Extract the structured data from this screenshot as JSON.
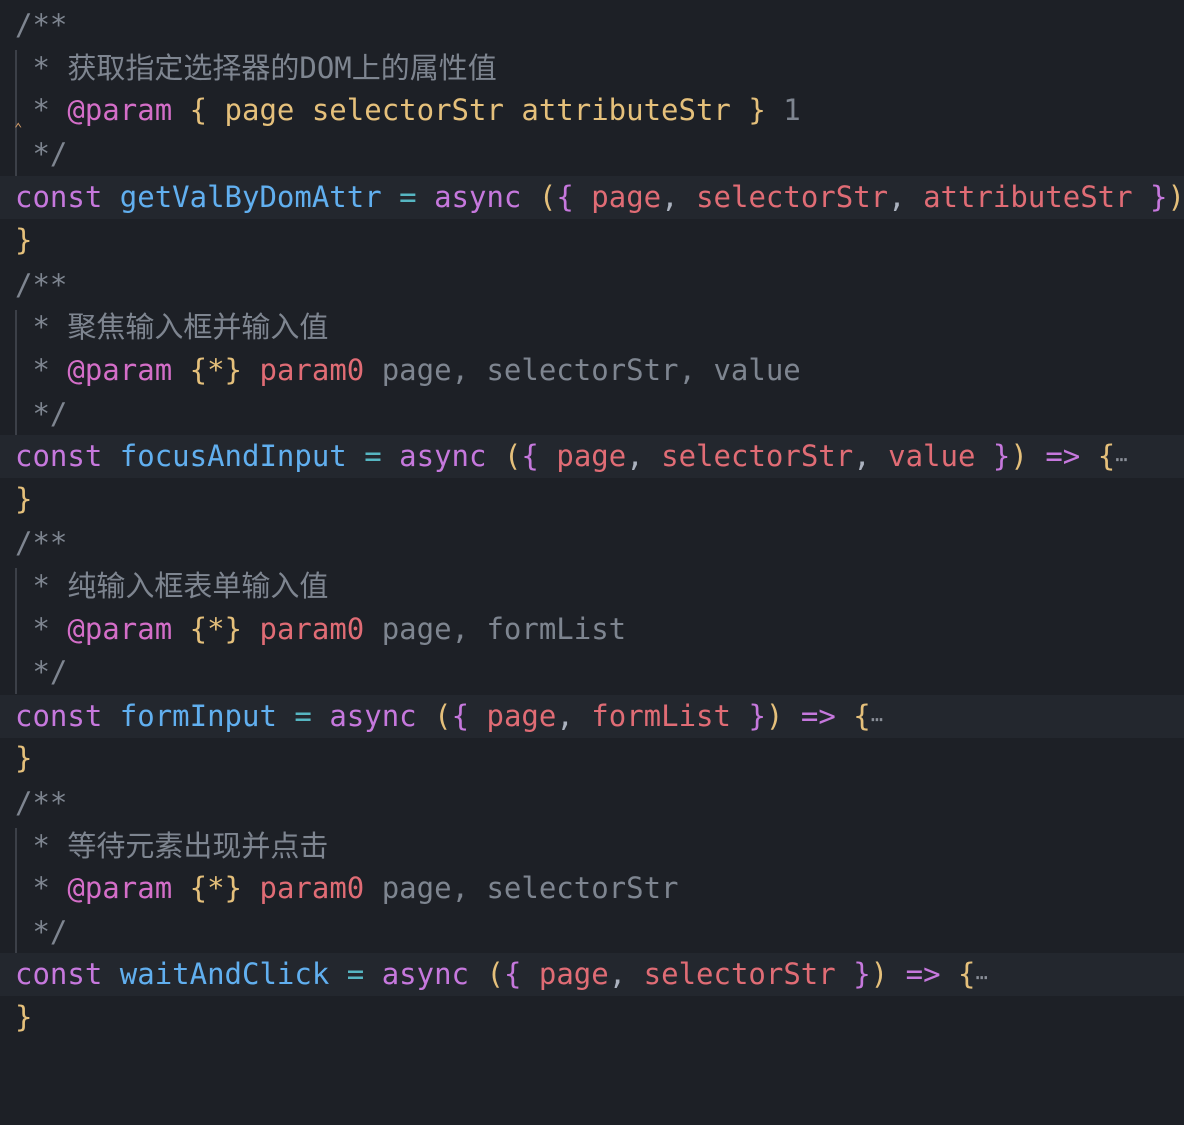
{
  "editor": {
    "theme_colors": {
      "background": "#1d2026",
      "line_highlight": "#23272e",
      "comment": "#7e8590",
      "keyword": "#c678dd",
      "function": "#61afef",
      "parameter": "#e06c75",
      "bracket": "#e5c07b"
    },
    "tokens": {
      "doc_open": "/**",
      "doc_close": " */",
      "star": " * ",
      "param_tag": "@param",
      "const_kw": "const",
      "async_kw": "async",
      "assign": "=",
      "arrow": "=>",
      "open_paren": "(",
      "close_paren": ")",
      "open_brace": "{",
      "close_brace": "}",
      "comma": ",",
      "any_type": "{*}",
      "param0": "param0",
      "collapsed_marker": "⋯"
    },
    "blocks": [
      {
        "description": "获取指定选择器的DOM上的属性值",
        "param_line": "{ page selectorStr attributeStr } 1",
        "param_type_open": "{",
        "param_type_body": " page selectorStr attributeStr ",
        "param_type_close": "}",
        "param_trailing": " 1",
        "function_name": "getValByDomAttr",
        "params": [
          "page",
          "selectorStr",
          "attributeStr"
        ]
      },
      {
        "description": "聚焦输入框并输入值",
        "param_desc": " page, selectorStr, value",
        "function_name": "focusAndInput",
        "params": [
          "page",
          "selectorStr",
          "value"
        ]
      },
      {
        "description": "纯输入框表单输入值",
        "param_desc": " page, formList",
        "function_name": "formInput",
        "params": [
          "page",
          "formList"
        ]
      },
      {
        "description": "等待元素出现并点击",
        "param_desc": " page, selectorStr",
        "function_name": "waitAndClick",
        "params": [
          "page",
          "selectorStr"
        ]
      }
    ]
  }
}
